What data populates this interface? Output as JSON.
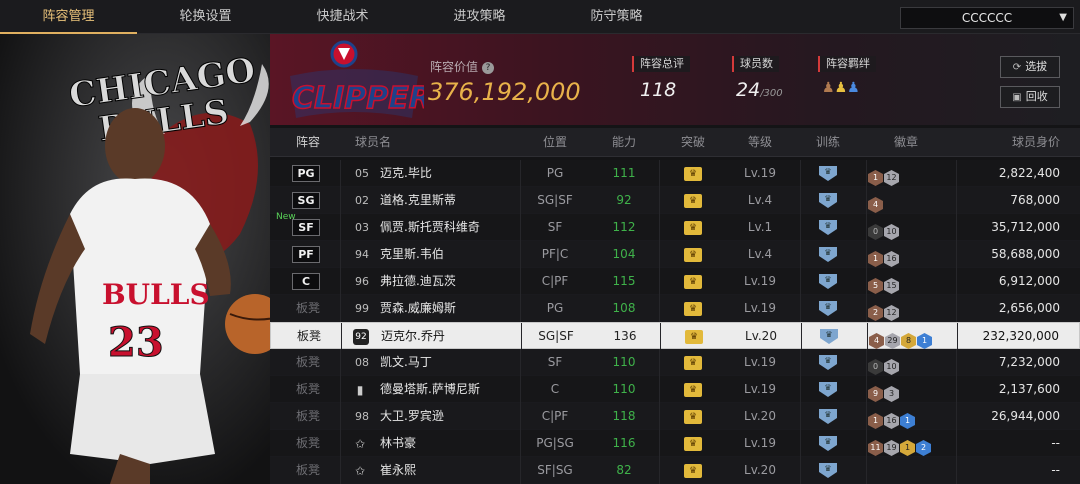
{
  "nav": {
    "tabs": [
      "阵容管理",
      "轮换设置",
      "快捷战术",
      "进攻策略",
      "防守策略"
    ],
    "active_tab": 0,
    "team_select": "CCCCCC"
  },
  "poster": {
    "team_text_1": "CHICAGO",
    "team_text_2": "BULLS",
    "jersey_text": "BULLS",
    "jersey_number": "23"
  },
  "header": {
    "logo_text": "CLIPPERS",
    "value_label": "阵容价值",
    "value": "376,192,000",
    "stats": [
      {
        "label": "阵容总评",
        "value": "118",
        "sub": ""
      },
      {
        "label": "球员数",
        "value": "24",
        "sub": "/300"
      },
      {
        "label": "阵容羁绊",
        "value": "",
        "sub": ""
      }
    ],
    "buttons": {
      "select": "选拔",
      "recycle": "回收"
    }
  },
  "table": {
    "columns": [
      "阵容",
      "球员名",
      "位置",
      "能力",
      "突破",
      "等级",
      "训练",
      "徽章",
      "球员身价"
    ],
    "rows": [
      {
        "slot": "PG",
        "is_badge": true,
        "num": "05",
        "name": "迈克.毕比",
        "pos": "PG",
        "ability": "111",
        "level": "Lv.19",
        "badges": [
          [
            "bronze",
            "1"
          ],
          [
            "silver",
            "12"
          ]
        ],
        "value": "2,822,400"
      },
      {
        "slot": "SG",
        "is_badge": true,
        "num": "02",
        "name": "道格.克里斯蒂",
        "pos": "SG|SF",
        "ability": "92",
        "level": "Lv.4",
        "badges": [
          [
            "bronze",
            "4"
          ]
        ],
        "value": "768,000"
      },
      {
        "slot": "SF",
        "is_badge": true,
        "new": "New",
        "num": "03",
        "name": "佩贾.斯托贾科维奇",
        "pos": "SF",
        "ability": "112",
        "level": "Lv.1",
        "badges": [
          [
            "dark",
            "0"
          ],
          [
            "silver",
            "10"
          ]
        ],
        "value": "35,712,000"
      },
      {
        "slot": "PF",
        "is_badge": true,
        "num": "94",
        "name": "克里斯.韦伯",
        "pos": "PF|C",
        "ability": "104",
        "level": "Lv.4",
        "badges": [
          [
            "bronze",
            "1"
          ],
          [
            "silver",
            "16"
          ]
        ],
        "value": "58,688,000"
      },
      {
        "slot": "C",
        "is_badge": true,
        "num": "96",
        "name": "弗拉德.迪瓦茨",
        "pos": "C|PF",
        "ability": "115",
        "level": "Lv.19",
        "badges": [
          [
            "bronze",
            "5"
          ],
          [
            "silver",
            "15"
          ]
        ],
        "value": "6,912,000"
      },
      {
        "slot": "板凳",
        "is_badge": false,
        "num": "99",
        "name": "贾森.威廉姆斯",
        "pos": "PG",
        "ability": "108",
        "level": "Lv.19",
        "badges": [
          [
            "bronze",
            "2"
          ],
          [
            "silver",
            "12"
          ]
        ],
        "value": "2,656,000"
      },
      {
        "slot": "板凳",
        "is_badge": false,
        "icon": "92",
        "name": "迈克尔.乔丹",
        "pos": "SG|SF",
        "ability": "136",
        "level": "Lv.20",
        "selected": true,
        "badges": [
          [
            "bronze",
            "4"
          ],
          [
            "silver",
            "29"
          ],
          [
            "gold",
            "8"
          ],
          [
            "blue",
            "1"
          ]
        ],
        "value": "232,320,000"
      },
      {
        "slot": "板凳",
        "is_badge": false,
        "num": "08",
        "name": "凯文.马丁",
        "pos": "SF",
        "ability": "110",
        "level": "Lv.19",
        "badges": [
          [
            "dark",
            "0"
          ],
          [
            "silver",
            "10"
          ]
        ],
        "value": "7,232,000"
      },
      {
        "slot": "板凳",
        "is_badge": false,
        "icon": "bars",
        "name": "德曼塔斯.萨博尼斯",
        "pos": "C",
        "ability": "110",
        "level": "Lv.19",
        "badges": [
          [
            "bronze",
            "9"
          ],
          [
            "silver",
            "3"
          ]
        ],
        "value": "2,137,600"
      },
      {
        "slot": "板凳",
        "is_badge": false,
        "num": "98",
        "name": "大卫.罗宾逊",
        "pos": "C|PF",
        "ability": "118",
        "level": "Lv.20",
        "badges": [
          [
            "bronze",
            "1"
          ],
          [
            "silver",
            "16"
          ],
          [
            "blue",
            "1"
          ]
        ],
        "value": "26,944,000"
      },
      {
        "slot": "板凳",
        "is_badge": false,
        "icon": "star",
        "name": "林书豪",
        "pos": "PG|SG",
        "ability": "116",
        "level": "Lv.19",
        "badges": [
          [
            "bronze",
            "11"
          ],
          [
            "silver",
            "19"
          ],
          [
            "gold",
            "1"
          ],
          [
            "blue",
            "2"
          ]
        ],
        "value": "--"
      },
      {
        "slot": "板凳",
        "is_badge": false,
        "icon": "star",
        "name": "崔永熙",
        "pos": "SF|SG",
        "ability": "82",
        "level": "Lv.20",
        "badges": [],
        "value": "--"
      }
    ]
  }
}
